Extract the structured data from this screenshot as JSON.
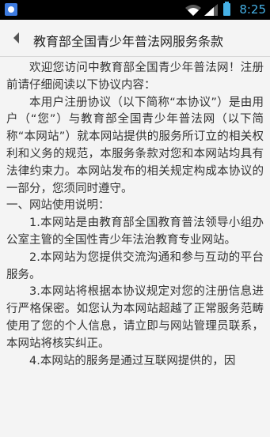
{
  "status_bar": {
    "time": "8:25",
    "icons": [
      "app-notification-icon",
      "wifi-icon",
      "signal-icon",
      "battery-icon"
    ]
  },
  "header": {
    "title": "教育部全国青少年普法网服务条款",
    "back_icon": "back-arrow-icon"
  },
  "content": {
    "paragraphs": [
      "欢迎您访问中教育部全国青少年普法网！注册前请仔细阅读以下协议内容：",
      "本用户注册协议（以下简称“本协议”）是由用户（“您”）与教育部全国青少年普法网（以下简称“本网站”）就本网站提供的服务所订立的相关权利和义务的规范，本服务条款对您和本网站均具有法律约束力。本网站发布的相关规定构成本协议的一部分，您须同时遵守。",
      "一、网站使用说明：",
      "1.本网站是由教育部全国教育普法领导小组办公室主管的全国性青少年法治教育专业网站。",
      "2.本网站为您提供交流沟通和参与互动的平台服务。",
      "3.本网站将根据本协议规定对您的注册信息进行严格保密。如您认为本网站超越了正常服务范畴使用了您的个人信息，请立即与网站管理员联系，本网站将核实纠正。",
      "4.本网站的服务是通过互联网提供的，因"
    ]
  },
  "colors": {
    "status_bar_bg": "#000000",
    "status_accent": "#46b1e6",
    "page_bg": "#f4f4f4",
    "text": "#333333"
  }
}
